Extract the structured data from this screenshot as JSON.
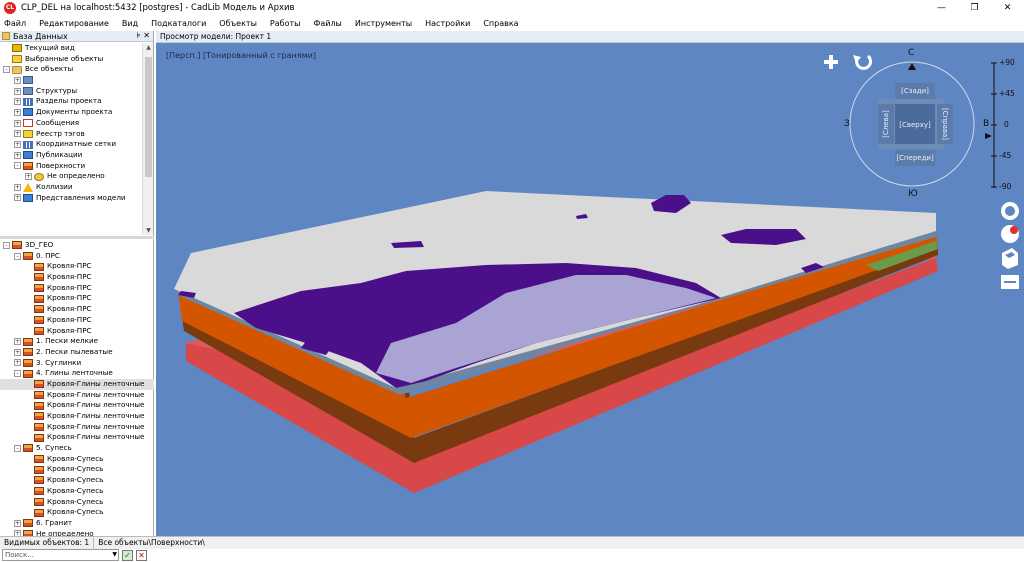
{
  "window": {
    "title": "CLP_DEL на localhost:5432 [postgres] - CadLib Модель и Архив",
    "app_icon": "CL",
    "buttons": [
      "—",
      "❐",
      "✕"
    ]
  },
  "menu": [
    "Файл",
    "Редактирование",
    "Вид",
    "Подкаталоги",
    "Объекты",
    "Работы",
    "Файлы",
    "Инструменты",
    "Настройки",
    "Справка"
  ],
  "left_panel": {
    "title": "База Данных",
    "pins": "⊧ ✕",
    "tree_top": [
      {
        "label": "Текущий вид",
        "icon": "doc",
        "indent": 0,
        "exp": ""
      },
      {
        "label": "Выбранные объекты",
        "icon": "tag",
        "indent": 0,
        "exp": ""
      },
      {
        "label": "Все объекты",
        "icon": "folder",
        "indent": 0,
        "exp": "-"
      },
      {
        "label": "",
        "icon": "generic",
        "indent": 1,
        "exp": "+"
      },
      {
        "label": "Структуры",
        "icon": "generic",
        "indent": 1,
        "exp": "+"
      },
      {
        "label": "Разделы проекта",
        "icon": "grid",
        "indent": 1,
        "exp": "+"
      },
      {
        "label": "Документы проекта",
        "icon": "pub",
        "indent": 1,
        "exp": "+"
      },
      {
        "label": "Сообщения",
        "icon": "mail",
        "indent": 1,
        "exp": "+"
      },
      {
        "label": "Реестр тэгов",
        "icon": "tag",
        "indent": 1,
        "exp": "+"
      },
      {
        "label": "Координатные сетки",
        "icon": "grid",
        "indent": 1,
        "exp": "+"
      },
      {
        "label": "Публикации",
        "icon": "pub",
        "indent": 1,
        "exp": "+"
      },
      {
        "label": "Поверхности",
        "icon": "surf",
        "indent": 1,
        "exp": "-"
      },
      {
        "label": "Не определено",
        "icon": "target",
        "indent": 2,
        "exp": "+"
      },
      {
        "label": "Коллизии",
        "icon": "warn",
        "indent": 1,
        "exp": "+"
      },
      {
        "label": "Представления модели",
        "icon": "pub",
        "indent": 1,
        "exp": "+"
      }
    ],
    "tree_bottom": [
      {
        "label": "3D_ГЕО",
        "icon": "surf",
        "indent": 0,
        "exp": "-"
      },
      {
        "label": "0. ПРС",
        "icon": "surf",
        "indent": 1,
        "exp": "-"
      },
      {
        "label": "Кровля-ПРС",
        "icon": "surf",
        "indent": 2,
        "exp": ""
      },
      {
        "label": "Кровля-ПРС",
        "icon": "surf",
        "indent": 2,
        "exp": ""
      },
      {
        "label": "Кровля-ПРС",
        "icon": "surf",
        "indent": 2,
        "exp": ""
      },
      {
        "label": "Кровля-ПРС",
        "icon": "surf",
        "indent": 2,
        "exp": ""
      },
      {
        "label": "Кровля-ПРС",
        "icon": "surf",
        "indent": 2,
        "exp": ""
      },
      {
        "label": "Кровля-ПРС",
        "icon": "surf",
        "indent": 2,
        "exp": ""
      },
      {
        "label": "Кровля-ПРС",
        "icon": "surf",
        "indent": 2,
        "exp": ""
      },
      {
        "label": "1. Пески мелкие",
        "icon": "surf",
        "indent": 1,
        "exp": "+"
      },
      {
        "label": "2. Пески пылеватые",
        "icon": "surf",
        "indent": 1,
        "exp": "+"
      },
      {
        "label": "3. Суглинки",
        "icon": "surf",
        "indent": 1,
        "exp": "+"
      },
      {
        "label": "4. Глины ленточные",
        "icon": "surf",
        "indent": 1,
        "exp": "-"
      },
      {
        "label": "Кровля-Глины ленточные",
        "icon": "surf",
        "indent": 2,
        "exp": "",
        "selected": true
      },
      {
        "label": "Кровля-Глины ленточные",
        "icon": "surf",
        "indent": 2,
        "exp": ""
      },
      {
        "label": "Кровля-Глины ленточные",
        "icon": "surf",
        "indent": 2,
        "exp": ""
      },
      {
        "label": "Кровля-Глины ленточные",
        "icon": "surf",
        "indent": 2,
        "exp": ""
      },
      {
        "label": "Кровля-Глины ленточные",
        "icon": "surf",
        "indent": 2,
        "exp": ""
      },
      {
        "label": "Кровля-Глины ленточные",
        "icon": "surf",
        "indent": 2,
        "exp": ""
      },
      {
        "label": "5. Супесь",
        "icon": "surf",
        "indent": 1,
        "exp": "-"
      },
      {
        "label": "Кровля-Супесь",
        "icon": "surf",
        "indent": 2,
        "exp": ""
      },
      {
        "label": "Кровля-Супесь",
        "icon": "surf",
        "indent": 2,
        "exp": ""
      },
      {
        "label": "Кровля-Супесь",
        "icon": "surf",
        "indent": 2,
        "exp": ""
      },
      {
        "label": "Кровля-Супесь",
        "icon": "surf",
        "indent": 2,
        "exp": ""
      },
      {
        "label": "Кровля-Супесь",
        "icon": "surf",
        "indent": 2,
        "exp": ""
      },
      {
        "label": "Кровля-Супесь",
        "icon": "surf",
        "indent": 2,
        "exp": ""
      },
      {
        "label": "6. Гранит",
        "icon": "surf",
        "indent": 1,
        "exp": "+"
      },
      {
        "label": "Не определено",
        "icon": "surf",
        "indent": 1,
        "exp": "+"
      }
    ],
    "search_placeholder": "Поиск..."
  },
  "viewport": {
    "header": "Просмотр модели: Проект 1",
    "mode_label": "[Персп.] [Тонированный с гранями]",
    "compass": {
      "north": "С",
      "south": "Ю",
      "west": "З",
      "east": "В"
    },
    "cube": {
      "top": "[Сверху]",
      "back": "[Сзади]",
      "front": "[Спереди]",
      "left": "[Слева]",
      "right": "[Справа]"
    },
    "tilt_ruler": [
      "+90",
      "+45",
      "0",
      "-45",
      "-90"
    ],
    "background": "#5e86c2",
    "layer_colors": {
      "top_surface": "#d9d9d9",
      "purple": "#4b0f8a",
      "lavender": "#a9a4d4",
      "orange": "#d45500",
      "brown": "#7a3a10",
      "green": "#6a9a4a",
      "red": "#d84848"
    }
  },
  "status": {
    "visible_objects": "Видимых объектов: 1",
    "path": "Все объекты\\Поверхности\\"
  }
}
